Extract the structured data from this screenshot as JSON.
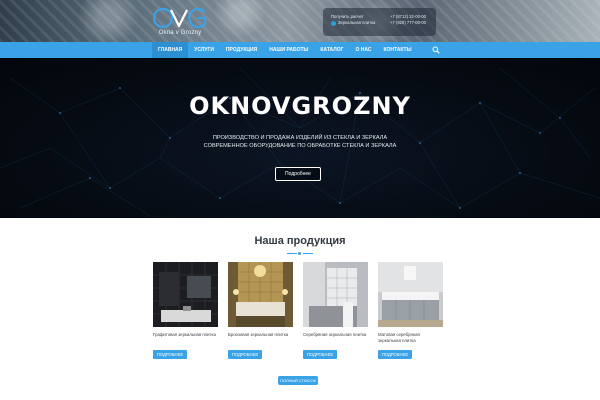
{
  "header": {
    "logo_mark": "OVG",
    "logo_sub": "Okna v Grozny",
    "contact": {
      "request_label": "Получить расчет",
      "tg_label": "Зеркальная плитка",
      "phone1": "+7 (8712) 22-00-00",
      "phone2": "+7 (928) 777-00-00"
    },
    "accent": "#3aa2e6"
  },
  "nav": {
    "items": [
      {
        "label": "ГЛАВНАЯ",
        "active": true
      },
      {
        "label": "УСЛУГИ"
      },
      {
        "label": "ПРОДУКЦИЯ"
      },
      {
        "label": "НАШИ РАБОТЫ"
      },
      {
        "label": "КАТАЛОГ"
      },
      {
        "label": "О НАС"
      },
      {
        "label": "КОНТАКТЫ"
      }
    ],
    "search_icon": "search-icon"
  },
  "hero": {
    "title": "OKNOVGROZNY",
    "line1": "ПРОИЗВОДСТВО И ПРОДАЖА ИЗДЕЛИЙ ИЗ СТЕКЛА И ЗЕРКАЛА",
    "line2": "СОВРЕМЕННОЕ ОБОРУДОВАНИЕ ПО ОБРАБОТКЕ СТЕКЛА И ЗЕРКАЛА",
    "button": "Подробнее"
  },
  "products": {
    "title": "Наша продукция",
    "items": [
      {
        "name": "Графитовая зеркальная плитка",
        "button": "ПОДРОБНЕЕ"
      },
      {
        "name": "Бронзовая зеркальная плитка",
        "button": "ПОДРОБНЕЕ"
      },
      {
        "name": "Серебряная зеркальная плитка",
        "button": "ПОДРОБНЕЕ"
      },
      {
        "name": "Матовая серебряная зеркальная плитка",
        "button": "ПОДРОБНЕЕ"
      }
    ],
    "full_list": "ПОЛНЫЙ СПИСОК"
  }
}
